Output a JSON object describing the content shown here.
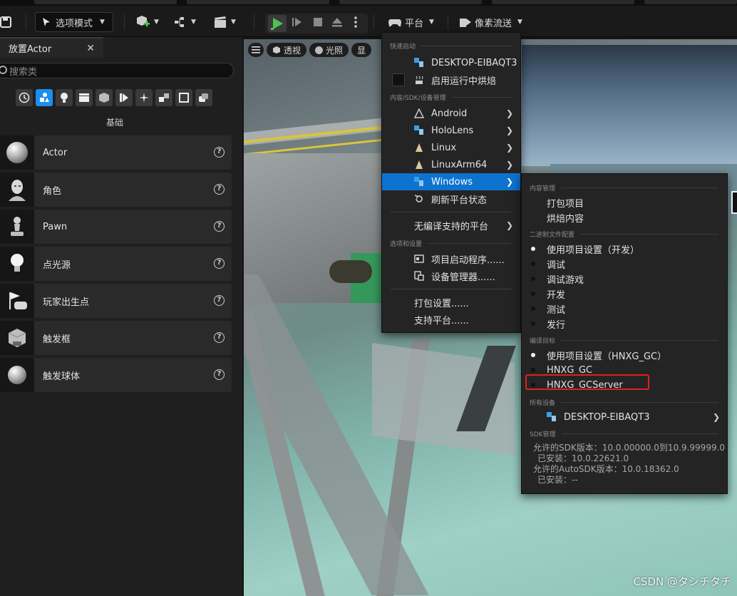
{
  "toolbar": {
    "mode_label": "选项模式",
    "platforms_label": "平台",
    "pixel_streaming_label": "像素流送"
  },
  "place_actor": {
    "tab_title": "放置Actor",
    "search_placeholder": "搜索类",
    "category_label": "基础",
    "items": [
      {
        "label": "Actor",
        "icon": "sphere-icon"
      },
      {
        "label": "角色",
        "icon": "character-icon"
      },
      {
        "label": "Pawn",
        "icon": "pawn-icon"
      },
      {
        "label": "点光源",
        "icon": "point-light-icon"
      },
      {
        "label": "玩家出生点",
        "icon": "player-start-icon"
      },
      {
        "label": "触发框",
        "icon": "trigger-box-icon"
      },
      {
        "label": "触发球体",
        "icon": "trigger-sphere-icon"
      }
    ]
  },
  "viewport": {
    "perspective_label": "透视",
    "lit_label": "光照",
    "show_label": "显"
  },
  "platforms_menu": {
    "section_quick_launch": "快速启动",
    "quick_launch_device": "DESKTOP-EIBAQT3",
    "cook_on_the_fly": "启用运行中烘焙",
    "section_content_sdk": "内容/SDK/设备管理",
    "platforms": [
      "Android",
      "HoloLens",
      "Linux",
      "LinuxArm64",
      "Windows"
    ],
    "refresh_platform_status": "刷新平台状态",
    "unsupported_platforms": "无编译支持的平台",
    "section_options": "选项和设置",
    "project_launcher": "项目启动程序......",
    "device_manager": "设备管理器......",
    "packaging_settings": "打包设置......",
    "supported_platforms": "支持平台......"
  },
  "windows_submenu": {
    "section_content_management": "内容管理",
    "package_project": "打包项目",
    "cook_content": "烘焙内容",
    "section_binary_config": "二进制文件配置",
    "binary_configs": [
      {
        "label": "使用项目设置（开发）",
        "selected": true
      },
      {
        "label": "调试",
        "selected": false
      },
      {
        "label": "调试游戏",
        "selected": false
      },
      {
        "label": "开发",
        "selected": false
      },
      {
        "label": "测试",
        "selected": false
      },
      {
        "label": "发行",
        "selected": false
      }
    ],
    "section_build_target": "编译目标",
    "build_targets": [
      {
        "label": "使用项目设置（HNXG_GC）",
        "selected": true
      },
      {
        "label": "HNXG_GC",
        "selected": false
      },
      {
        "label": "HNXG_GCServer",
        "selected": false
      }
    ],
    "section_all_devices": "所有设备",
    "device": "DESKTOP-EIBAQT3",
    "section_sdk_management": "SDK管理",
    "sdk_lines": [
      "允许的SDK版本：10.0.00000.0到10.9.99999.0",
      "已安装：10.0.22621.0",
      "允许的AutoSDK版本：10.0.18362.0",
      "已安装：--"
    ]
  },
  "watermark": "CSDN @タシチタチ",
  "colors": {
    "highlight": "#0d73cf",
    "annotation_red": "#e02020",
    "active_category": "#1a8ff0"
  }
}
